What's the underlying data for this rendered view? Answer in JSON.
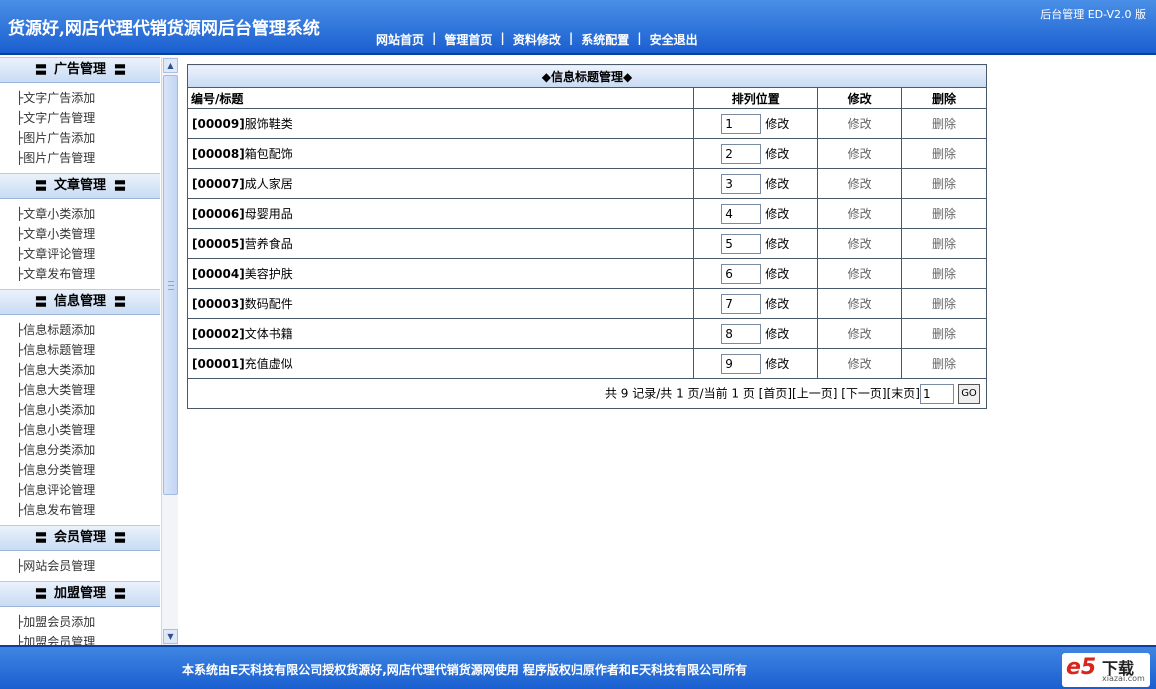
{
  "header": {
    "site_title": "货源好,网店代理代销货源网后台管理系统",
    "version_text": "后台管理 ED-V2.0 版",
    "nav": [
      "网站首页",
      "管理首页",
      "资料修改",
      "系统配置",
      "安全退出"
    ],
    "nav_sep": "|"
  },
  "sidebar": {
    "groups": [
      {
        "title": "广告管理",
        "items": [
          "文字广告添加",
          "文字广告管理",
          "图片广告添加",
          "图片广告管理"
        ]
      },
      {
        "title": "文章管理",
        "items": [
          "文章小类添加",
          "文章小类管理",
          "文章评论管理",
          "文章发布管理"
        ]
      },
      {
        "title": "信息管理",
        "items": [
          "信息标题添加",
          "信息标题管理",
          "信息大类添加",
          "信息大类管理",
          "信息小类添加",
          "信息小类管理",
          "信息分类添加",
          "信息分类管理",
          "信息评论管理",
          "信息发布管理"
        ]
      },
      {
        "title": "会员管理",
        "items": [
          "网站会员管理"
        ]
      },
      {
        "title": "加盟管理",
        "items": [
          "加盟会员添加",
          "加盟会员管理"
        ]
      }
    ]
  },
  "main": {
    "table_title": "◆信息标题管理◆",
    "columns": [
      "编号/标题",
      "排列位置",
      "修改",
      "删除"
    ],
    "edit_label": "修改",
    "delete_label": "删除",
    "rows": [
      {
        "code": "[00009]",
        "name": "服饰鞋类",
        "order": "1"
      },
      {
        "code": "[00008]",
        "name": "箱包配饰",
        "order": "2"
      },
      {
        "code": "[00007]",
        "name": "成人家居",
        "order": "3"
      },
      {
        "code": "[00006]",
        "name": "母婴用品",
        "order": "4"
      },
      {
        "code": "[00005]",
        "name": "营养食品",
        "order": "5"
      },
      {
        "code": "[00004]",
        "name": "美容护肤",
        "order": "6"
      },
      {
        "code": "[00003]",
        "name": "数码配件",
        "order": "7"
      },
      {
        "code": "[00002]",
        "name": "文体书籍",
        "order": "8"
      },
      {
        "code": "[00001]",
        "name": "充值虚似",
        "order": "9"
      }
    ],
    "pager": {
      "summary": "共 9 记录/共 1 页/当前 1 页",
      "first": "[首页]",
      "prev": "[上一页]",
      "next": "[下一页]",
      "last": "[末页]",
      "page_value": "1",
      "go_label": "GO"
    }
  },
  "footer": {
    "copyright": "本系统由E天科技有限公司授权货源好,网店代理代销货源网使用  程序版权归原作者和E天科技有限公司所有",
    "logo_mark": "e5",
    "logo_text": "下载",
    "logo_domain": "xiazai.com"
  }
}
